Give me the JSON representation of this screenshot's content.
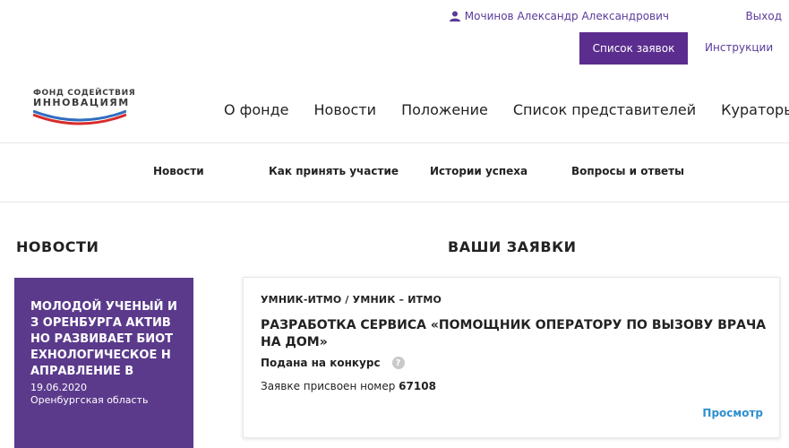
{
  "header": {
    "user_name": "Мочинов Александр Александрович",
    "logout_label": "Выход",
    "applications_button": "Список заявок",
    "instructions_link": "Инструкции"
  },
  "logo": {
    "line1": "ФОНД СОДЕЙСТВИЯ",
    "line2": "ИННОВАЦИЯМ"
  },
  "main_nav": [
    {
      "label": "О фонде"
    },
    {
      "label": "Новости"
    },
    {
      "label": "Положение"
    },
    {
      "label": "Список представителей"
    },
    {
      "label": "Кураторы"
    }
  ],
  "sub_nav": [
    {
      "label": "Новости"
    },
    {
      "label": "Как принять участие"
    },
    {
      "label": "Истории успеха"
    },
    {
      "label": "Вопросы и ответы"
    }
  ],
  "news": {
    "heading": "НОВОСТИ",
    "card": {
      "title": "МОЛОДОЙ УЧЕНЫЙ ИЗ ОРЕНБУРГА АКТИВНО РАЗВИВАЕТ БИОТЕХНОЛОГИЧЕСКОЕ НАПРАВЛЕНИЕ В",
      "date": "19.06.2020",
      "region": "Оренбургская область"
    }
  },
  "applications": {
    "heading": "ВАШИ ЗАЯВКИ",
    "items": [
      {
        "program": "УМНИК-ИТМО / УМНИК – ИТМО",
        "title": "РАЗРАБОТКА СЕРВИСА «ПОМОЩНИК ОПЕРАТОРУ ПО ВЫЗОВУ ВРАЧА НА ДОМ»",
        "status": "Подана на конкурс",
        "number_label": "Заявке присвоен номер",
        "number": "67108",
        "view_label": "Просмотр"
      }
    ]
  },
  "colors": {
    "brand_purple": "#5b2d8e",
    "link_purple": "#5b3a9c",
    "link_blue": "#2f8fcf"
  }
}
